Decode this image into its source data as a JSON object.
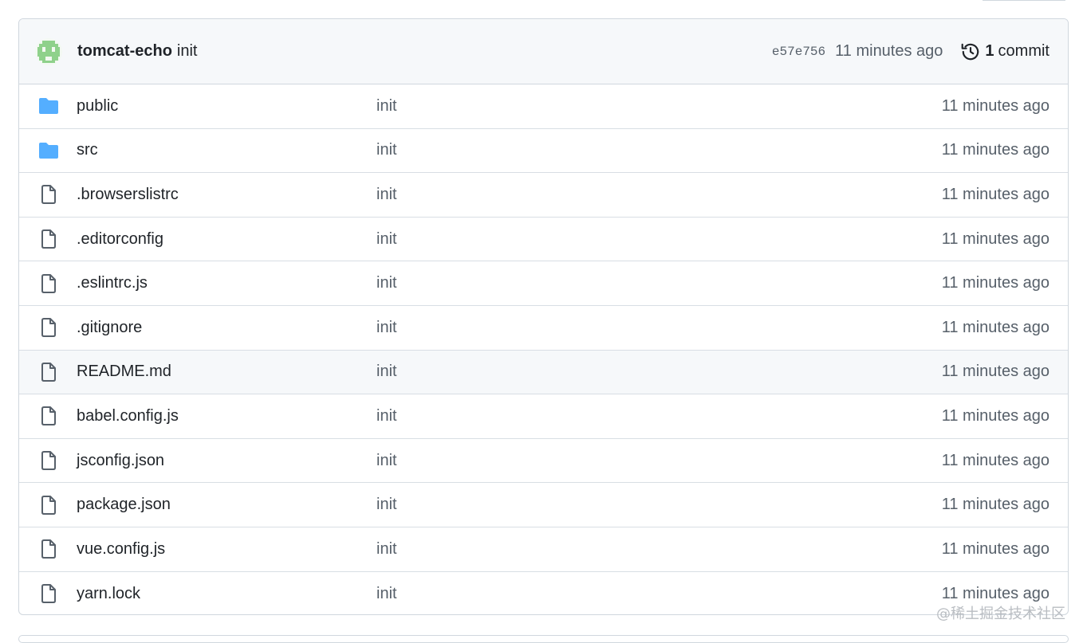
{
  "latest_commit": {
    "author": "tomcat-echo",
    "message": "init",
    "sha": "e57e756",
    "time": "11 minutes ago",
    "commit_count": "1",
    "commit_label": "commit"
  },
  "files": [
    {
      "name": "public",
      "type": "folder",
      "message": "init",
      "time": "11 minutes ago"
    },
    {
      "name": "src",
      "type": "folder",
      "message": "init",
      "time": "11 minutes ago"
    },
    {
      "name": ".browserslistrc",
      "type": "file",
      "message": "init",
      "time": "11 minutes ago"
    },
    {
      "name": ".editorconfig",
      "type": "file",
      "message": "init",
      "time": "11 minutes ago"
    },
    {
      "name": ".eslintrc.js",
      "type": "file",
      "message": "init",
      "time": "11 minutes ago"
    },
    {
      "name": ".gitignore",
      "type": "file",
      "message": "init",
      "time": "11 minutes ago"
    },
    {
      "name": "README.md",
      "type": "file",
      "message": "init",
      "time": "11 minutes ago",
      "highlighted": true
    },
    {
      "name": "babel.config.js",
      "type": "file",
      "message": "init",
      "time": "11 minutes ago"
    },
    {
      "name": "jsconfig.json",
      "type": "file",
      "message": "init",
      "time": "11 minutes ago"
    },
    {
      "name": "package.json",
      "type": "file",
      "message": "init",
      "time": "11 minutes ago"
    },
    {
      "name": "vue.config.js",
      "type": "file",
      "message": "init",
      "time": "11 minutes ago"
    },
    {
      "name": "yarn.lock",
      "type": "file",
      "message": "init",
      "time": "11 minutes ago"
    }
  ],
  "icons": {
    "folder": "folder-icon",
    "file": "file-icon",
    "history": "history-icon"
  },
  "colors": {
    "folder": "#54aeff",
    "file_icon": "#57606a",
    "avatar": "#8fd18b",
    "border": "#d0d7de",
    "header_bg": "#f6f8fa"
  },
  "watermark": "@稀土掘金技术社区"
}
